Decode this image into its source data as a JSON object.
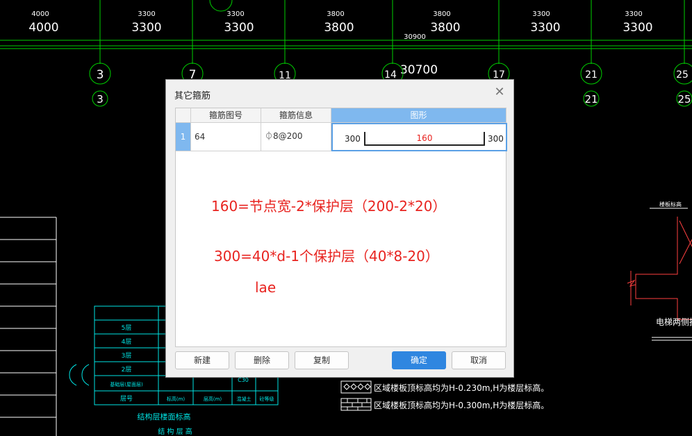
{
  "cad": {
    "top_dims_small": [
      "4000",
      "3300",
      "3300",
      "3800",
      "3800",
      "3300",
      "3300"
    ],
    "top_dims_large": [
      "4000",
      "3300",
      "3300",
      "3800",
      "3800",
      "3300",
      "3300"
    ],
    "total_small": "30900",
    "total_large": "30700",
    "axis_labels_circle": [
      "3",
      "7",
      "11",
      "14",
      "17",
      "21",
      "25"
    ],
    "axis_labels_small": [
      "3",
      "21",
      "25"
    ],
    "table_rows": [
      "5层",
      "4层",
      "3层",
      "2层",
      "基础层(屋面层)",
      "层号"
    ],
    "table_cols": [
      "标高(m)",
      "层高(m)",
      "混凝土",
      "砼等级"
    ],
    "table_extra": "C30",
    "table_caption": "结构层楼面标高",
    "table_caption2": "结 构 层 高",
    "left_vertical": "结构层楼面标高",
    "legend_1": "区域楼板顶标高均为H-0.230m,H为楼层标高。",
    "legend_2": "区域楼板顶标高均为H-0.300m,H为楼层标高。",
    "right_label": "电梯两侧挑板位",
    "right_small": "楼板标高",
    "colors": {
      "line": "#00ff00",
      "cyan": "#00ffff",
      "white": "#ffffff",
      "red": "#ff3030"
    }
  },
  "dialog": {
    "title": "其它箍筋",
    "close_icon": "close-icon",
    "columns": [
      "箍筋图号",
      "箍筋信息",
      "图形"
    ],
    "row": {
      "num": "1",
      "code": "64",
      "info": "⏀8@200",
      "shape": {
        "left": "300",
        "middle": "160",
        "right": "300"
      }
    },
    "notes": [
      "160=节点宽-2*保护层（200-2*20）",
      "300=40*d-1个保护层（40*8-20）",
      "lae"
    ],
    "buttons": {
      "new": "新建",
      "delete": "删除",
      "copy": "复制",
      "ok": "确定",
      "cancel": "取消"
    },
    "accent": "#2f86e0"
  }
}
